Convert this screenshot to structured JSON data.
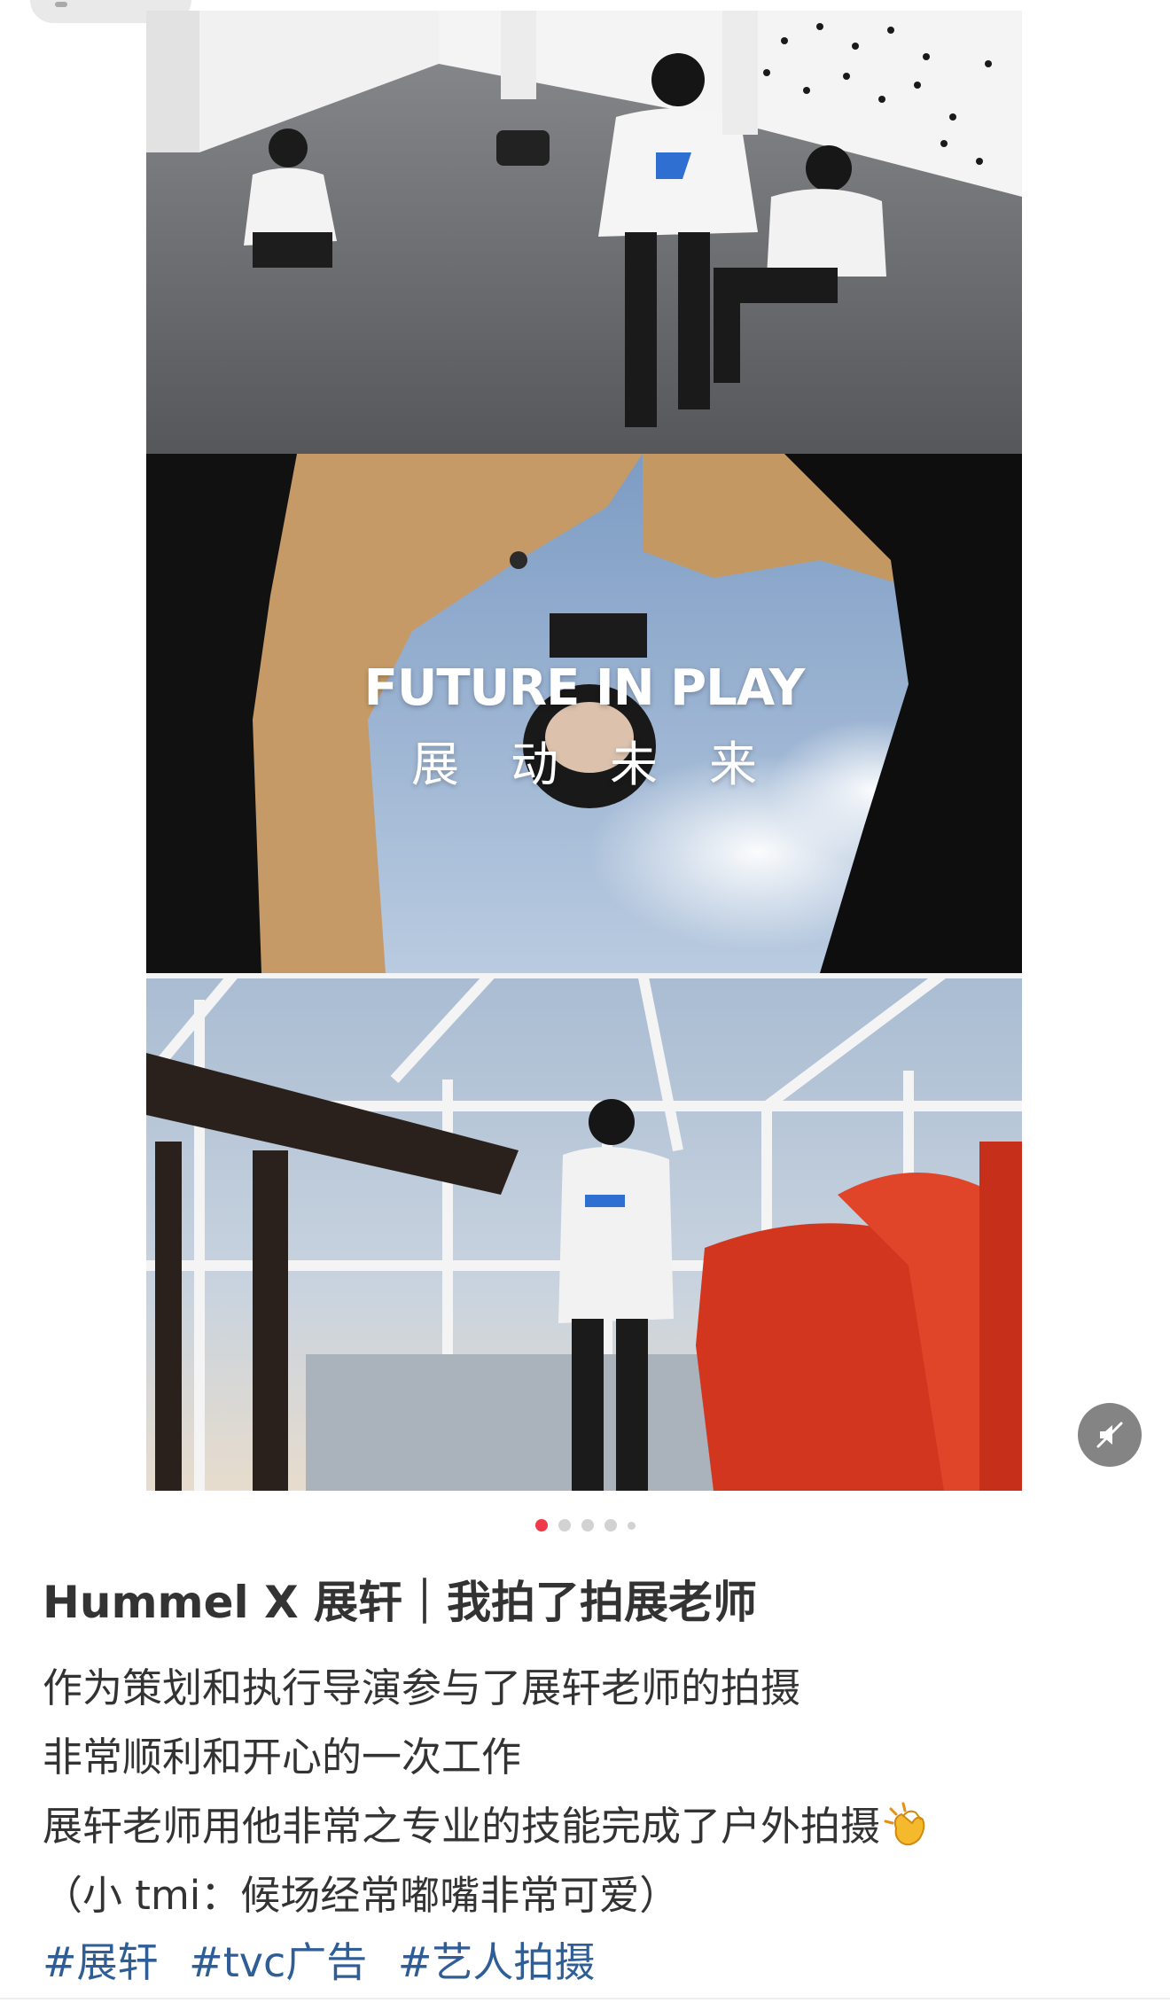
{
  "carousel": {
    "overlay_title": "FUTURE IN PLAY",
    "overlay_subtitle": "展动未来",
    "page_count": 5,
    "active_page": 1,
    "sound_icon": "speaker-muted-icon"
  },
  "post": {
    "title": "Hummel X 展轩｜我拍了拍展老师",
    "body_lines": [
      "作为策划和执行导演参与了展轩老师的拍摄",
      "非常顺利和开心的一次工作",
      "展轩老师用他非常之专业的技能完成了户外拍摄",
      "（小 tmi：候场经常嘟嘴非常可爱）"
    ],
    "body_emoji": "clapping-hands-icon",
    "tags": [
      "#展轩",
      "#tvc广告",
      "#艺人拍摄"
    ]
  },
  "colors": {
    "accent": "#ef3a4a",
    "tag": "#2f5d96",
    "text": "#333333"
  }
}
